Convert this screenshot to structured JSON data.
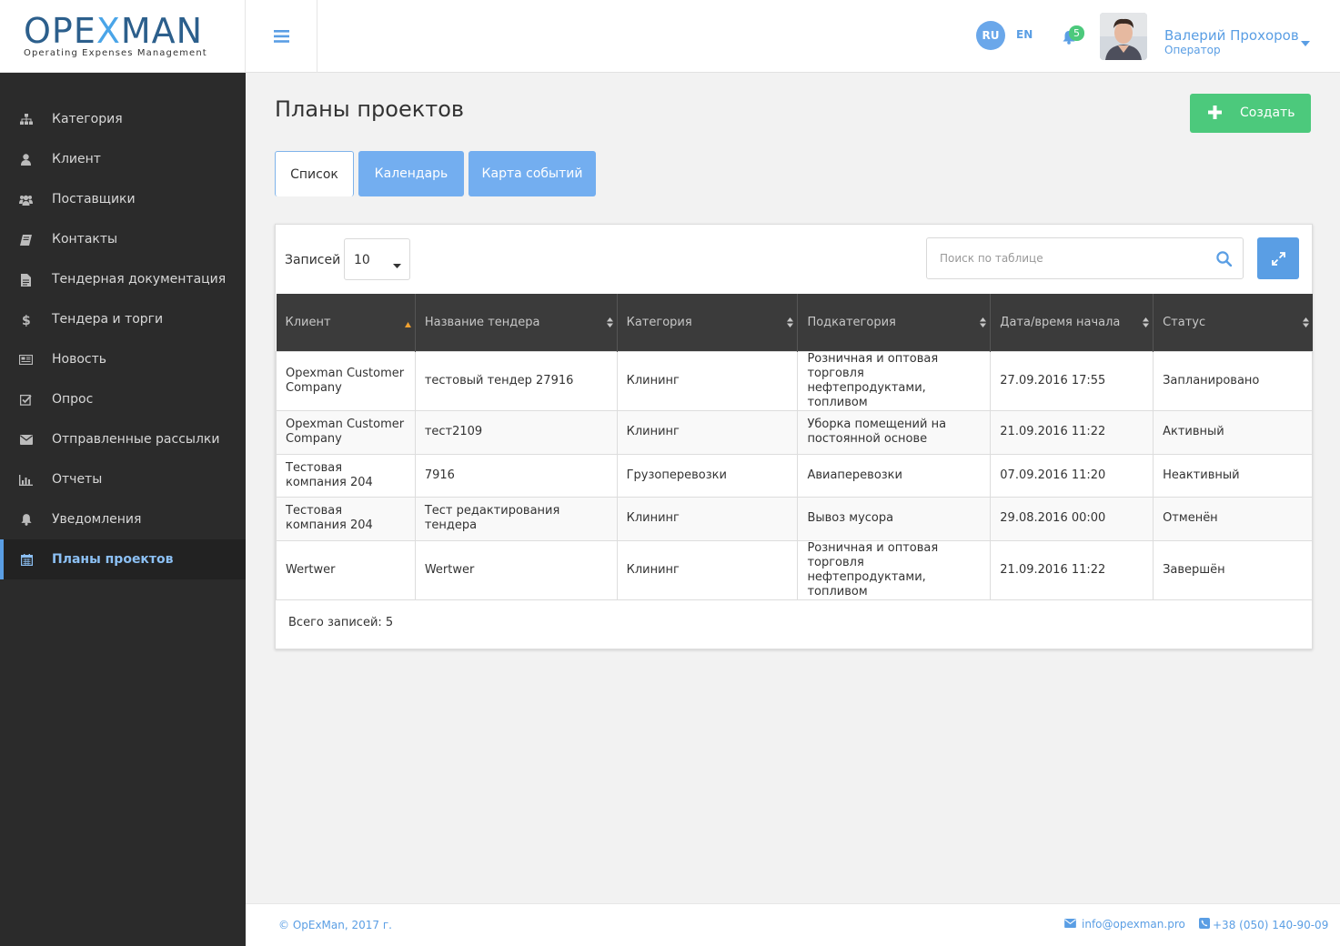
{
  "header": {
    "logo_main": "OPEXMAN",
    "logo_part1": "OPE",
    "logo_part2": "X",
    "logo_part3": "MAN",
    "logo_sub": "Operating Expenses Management",
    "lang_ru": "RU",
    "lang_en": "EN",
    "notifications_count": "5",
    "user_name": "Валерий Прохоров",
    "user_role": "Оператор"
  },
  "sidebar": {
    "items": [
      {
        "label": "Категория",
        "icon": "sitemap-icon"
      },
      {
        "label": "Клиент",
        "icon": "user-icon"
      },
      {
        "label": "Поставщики",
        "icon": "users-icon"
      },
      {
        "label": "Контакты",
        "icon": "book-icon"
      },
      {
        "label": "Тендерная документация",
        "icon": "file-icon"
      },
      {
        "label": "Тендера и торги",
        "icon": "dollar-icon"
      },
      {
        "label": "Новость",
        "icon": "newspaper-icon"
      },
      {
        "label": "Опрос",
        "icon": "checkbox-icon"
      },
      {
        "label": "Отправленные рассылки",
        "icon": "envelope-icon"
      },
      {
        "label": "Отчеты",
        "icon": "bar-chart-icon"
      },
      {
        "label": "Уведомления",
        "icon": "bell-icon"
      },
      {
        "label": "Планы проектов",
        "icon": "calendar-icon",
        "active": true
      }
    ]
  },
  "main": {
    "title": "Планы проектов",
    "create_label": "Создать",
    "tabs": [
      {
        "label": "Список",
        "active": true
      },
      {
        "label": "Календарь"
      },
      {
        "label": "Карта событий"
      }
    ],
    "length_label": "Записей",
    "length_value": "10",
    "search_placeholder": "Поиск по таблице",
    "table": {
      "columns": [
        "Клиент",
        "Название тендера",
        "Категория",
        "Подкатегория",
        "Дата/время начала",
        "Статус"
      ],
      "rows": [
        [
          "Opexman Customer Company",
          "тестовый тендер 27916",
          "Клининг",
          "Розничная и оптовая торговля нефтепродуктами, топливом",
          "27.09.2016 17:55",
          "Запланировано"
        ],
        [
          "Opexman Customer Company",
          "тест2109",
          "Клининг",
          "Уборка помещений на  постоянной основе",
          "21.09.2016 11:22",
          "Активный"
        ],
        [
          "Тестовая компания 204",
          "7916",
          "Грузоперевозки",
          "Авиаперевозки",
          "07.09.2016 11:20",
          "Неактивный"
        ],
        [
          "Тестовая компания 204",
          "Тест редактирования тендера",
          "Клининг",
          "Вывоз мусора",
          "29.08.2016 00:00",
          "Отменён"
        ],
        [
          "Wertwer",
          "Wertwer",
          "Клининг",
          "Розничная и оптовая торговля нефтепродуктами, топливом",
          "21.09.2016 11:22",
          "Завершён"
        ]
      ]
    },
    "total_label": "Всего записей: 5"
  },
  "footer": {
    "copyright": "© OpExMan, 2017 г.",
    "email": "info@opexman.pro",
    "phone": "+38 (050) 140-90-09"
  },
  "colors": {
    "accent": "#5a9ee4",
    "success": "#4cc97c",
    "sidebar_bg": "#2b2b2b",
    "table_header_bg": "#3b3b3b"
  }
}
